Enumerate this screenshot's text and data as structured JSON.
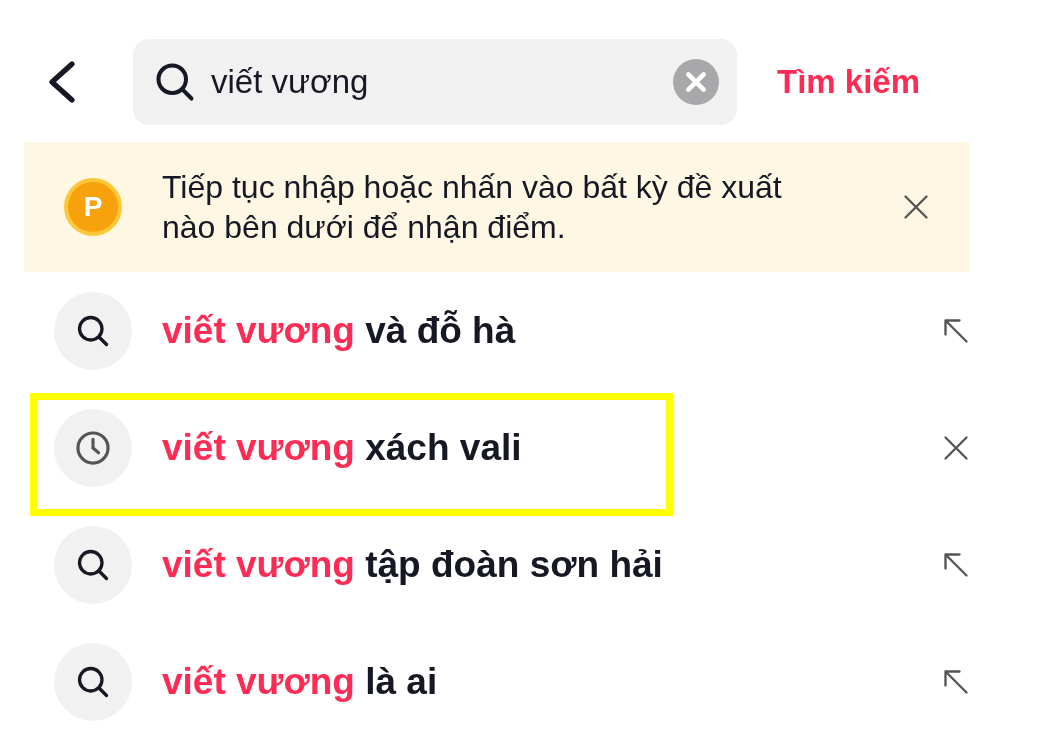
{
  "header": {
    "query": "viết vương",
    "submit": "Tìm kiếm"
  },
  "banner": {
    "badge": "P",
    "text": "Tiếp tục nhập hoặc nhấn vào bất kỳ đề xuất nào bên dưới để nhận điểm."
  },
  "suggestions": [
    {
      "kind": "search",
      "match": "viết vương",
      "rest": "và đỗ hà",
      "highlighted": false
    },
    {
      "kind": "history",
      "match": "viết vương",
      "rest": "xách vali",
      "highlighted": true
    },
    {
      "kind": "search",
      "match": "viết vương",
      "rest": "tập đoàn sơn hải",
      "highlighted": false
    },
    {
      "kind": "search",
      "match": "viết vương",
      "rest": "là ai",
      "highlighted": false
    }
  ]
}
